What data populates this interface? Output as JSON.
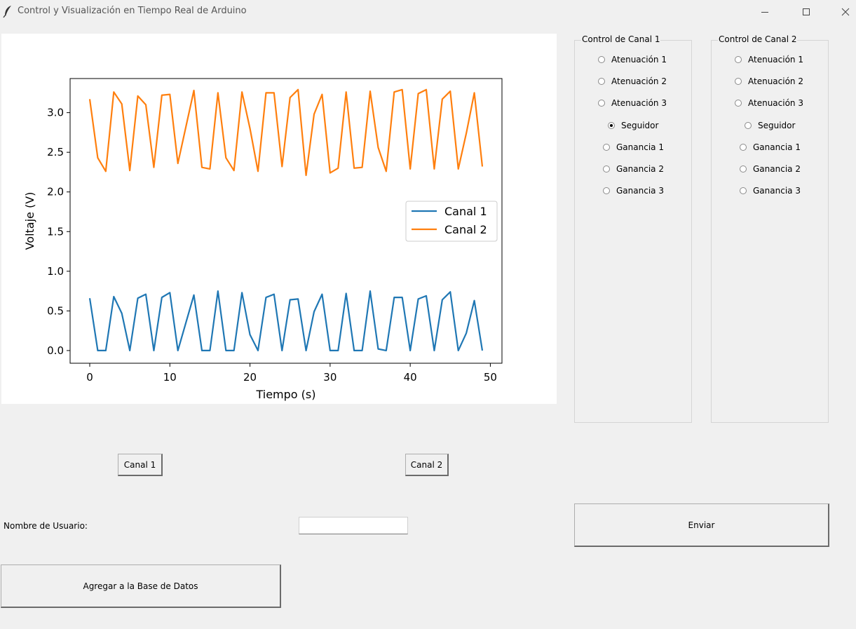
{
  "window": {
    "title": "Control y Visualización en Tiempo Real de Arduino",
    "icon": "feather-icon"
  },
  "chart_data": {
    "type": "line",
    "xlabel": "Tiempo (s)",
    "ylabel": "Voltaje (V)",
    "xlim": [
      -2.45,
      51.45
    ],
    "ylim": [
      -0.16,
      3.43
    ],
    "xticks": [
      "0",
      "10",
      "20",
      "30",
      "40",
      "50"
    ],
    "yticks": [
      "0.0",
      "0.5",
      "1.0",
      "1.5",
      "2.0",
      "2.5",
      "3.0"
    ],
    "legend_position": "center-right",
    "grid": false,
    "x": [
      0,
      1,
      2,
      3,
      4,
      5,
      6,
      7,
      8,
      9,
      10,
      11,
      12,
      13,
      14,
      15,
      16,
      17,
      18,
      19,
      20,
      21,
      22,
      23,
      24,
      25,
      26,
      27,
      28,
      29,
      30,
      31,
      32,
      33,
      34,
      35,
      36,
      37,
      38,
      39,
      40,
      41,
      42,
      43,
      44,
      45,
      46,
      47,
      48,
      49
    ],
    "series": [
      {
        "name": "Canal 1",
        "color": "#1f77b4",
        "values": [
          0.66,
          0.0,
          0.0,
          0.68,
          0.47,
          0.0,
          0.66,
          0.71,
          0.0,
          0.67,
          0.73,
          0.0,
          0.35,
          0.7,
          0.0,
          0.0,
          0.75,
          0.0,
          0.0,
          0.73,
          0.2,
          0.0,
          0.67,
          0.71,
          0.0,
          0.64,
          0.65,
          0.0,
          0.49,
          0.71,
          0.0,
          0.0,
          0.72,
          0.0,
          0.0,
          0.75,
          0.02,
          0.0,
          0.67,
          0.67,
          0.0,
          0.65,
          0.69,
          0.0,
          0.64,
          0.74,
          0.0,
          0.22,
          0.63,
          0.0
        ]
      },
      {
        "name": "Canal 2",
        "color": "#ff7f0e",
        "values": [
          3.17,
          2.43,
          2.26,
          3.26,
          3.11,
          2.27,
          3.21,
          3.1,
          2.31,
          3.22,
          3.23,
          2.36,
          2.82,
          3.28,
          2.31,
          2.29,
          3.25,
          2.43,
          2.27,
          3.26,
          2.8,
          2.26,
          3.25,
          3.25,
          2.32,
          3.19,
          3.29,
          2.21,
          2.98,
          3.23,
          2.24,
          2.3,
          3.26,
          2.3,
          2.31,
          3.27,
          2.56,
          2.26,
          3.26,
          3.29,
          2.29,
          3.24,
          3.29,
          2.29,
          3.17,
          3.27,
          2.29,
          2.74,
          3.25,
          2.32
        ]
      }
    ]
  },
  "channel1": {
    "title": "Control de Canal 1",
    "options": [
      "Atenuación 1",
      "Atenuación 2",
      "Atenuación 3",
      "Seguidor",
      "Ganancia 1",
      "Ganancia 2",
      "Ganancia 3"
    ],
    "selected": "Seguidor"
  },
  "channel2": {
    "title": "Control de Canal 2",
    "options": [
      "Atenuación 1",
      "Atenuación 2",
      "Atenuación 3",
      "Seguidor",
      "Ganancia 1",
      "Ganancia 2",
      "Ganancia 3"
    ],
    "selected": ""
  },
  "buttons": {
    "canal1": "Canal 1",
    "canal2": "Canal 2",
    "enviar": "Enviar",
    "agregar": "Agregar a la Base de Datos"
  },
  "form": {
    "username_label": "Nombre de Usuario:",
    "username_value": ""
  }
}
